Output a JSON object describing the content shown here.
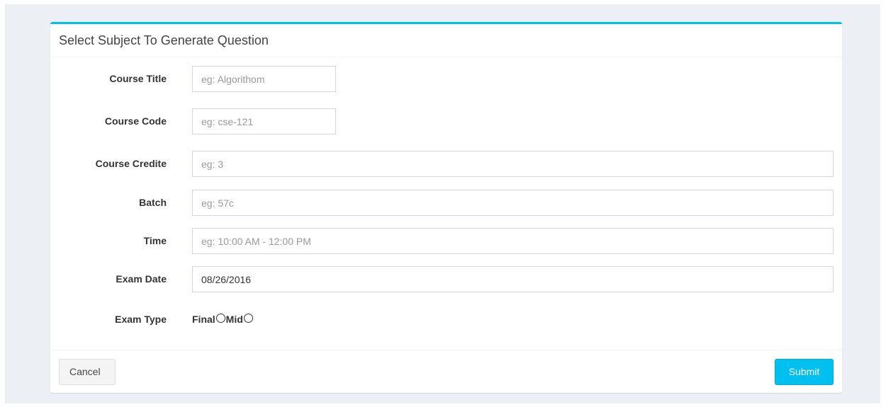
{
  "panel": {
    "title": "Select Subject To Generate Question"
  },
  "form": {
    "course_title": {
      "label": "Course Title",
      "value": "",
      "placeholder": "eg: Algorithom"
    },
    "course_code": {
      "label": "Course Code",
      "value": "",
      "placeholder": "eg: cse-121"
    },
    "course_credit": {
      "label": "Course Credite",
      "value": "",
      "placeholder": "eg: 3"
    },
    "batch": {
      "label": "Batch",
      "value": "",
      "placeholder": "eg: 57c"
    },
    "time": {
      "label": "Time",
      "value": "",
      "placeholder": "eg: 10:00 AM - 12:00 PM"
    },
    "exam_date": {
      "label": "Exam Date",
      "value": "08/26/2016",
      "placeholder": ""
    },
    "exam_type": {
      "label": "Exam Type",
      "options": [
        "Final",
        "Mid"
      ],
      "selected": ""
    }
  },
  "footer": {
    "cancel_label": "Cancel",
    "submit_label": "Submit"
  },
  "colors": {
    "accent": "#00c0ef",
    "page_background": "#ecf0f5"
  }
}
